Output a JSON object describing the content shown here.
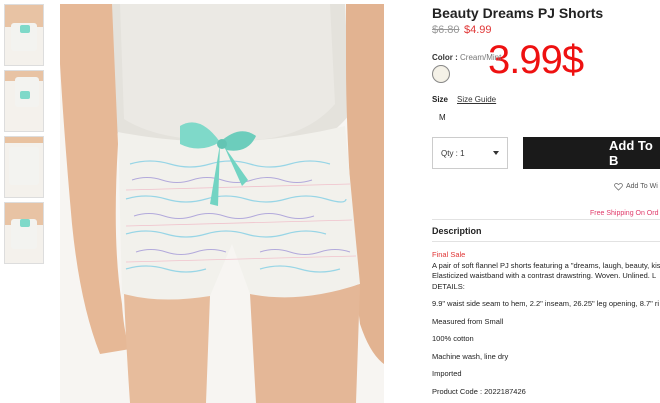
{
  "product": {
    "title": "Beauty Dreams PJ Shorts",
    "price_original": "$6.80",
    "price_sale": "$4.99",
    "overlay_price": "3.99$"
  },
  "color": {
    "label": "Color :",
    "value": "Cream/Mint"
  },
  "size": {
    "label": "Size",
    "guide_link": "Size Guide",
    "option": "M"
  },
  "quantity": {
    "label": "Qty : 1"
  },
  "actions": {
    "add_to_bag": "Add To B",
    "wishlist": "Add To Wi",
    "shipping": "Free Shipping On Ord"
  },
  "description": {
    "heading": "Description",
    "final_sale": "Final Sale",
    "lines": [
      "A pair of soft flannel PJ shorts featuring a \"dreams, laugh, beauty, kis",
      "Elasticized waistband with a contrast drawstring. Woven. Unlined. L",
      "DETAILS:"
    ],
    "details": [
      "9.9\" waist side seam to hem, 2.2\" inseam, 26.25\" leg opening, 8.7\" ri",
      "Measured from Small",
      "100% cotton",
      "Machine wash, line dry",
      "Imported",
      "Product Code : 2022187426"
    ]
  },
  "colors": {
    "accent_red": "#e03636",
    "big_price_red": "#ee1111",
    "button_black": "#1a1a1a",
    "shipping_pink": "#e03a6a",
    "mint": "#7fd9c9"
  }
}
